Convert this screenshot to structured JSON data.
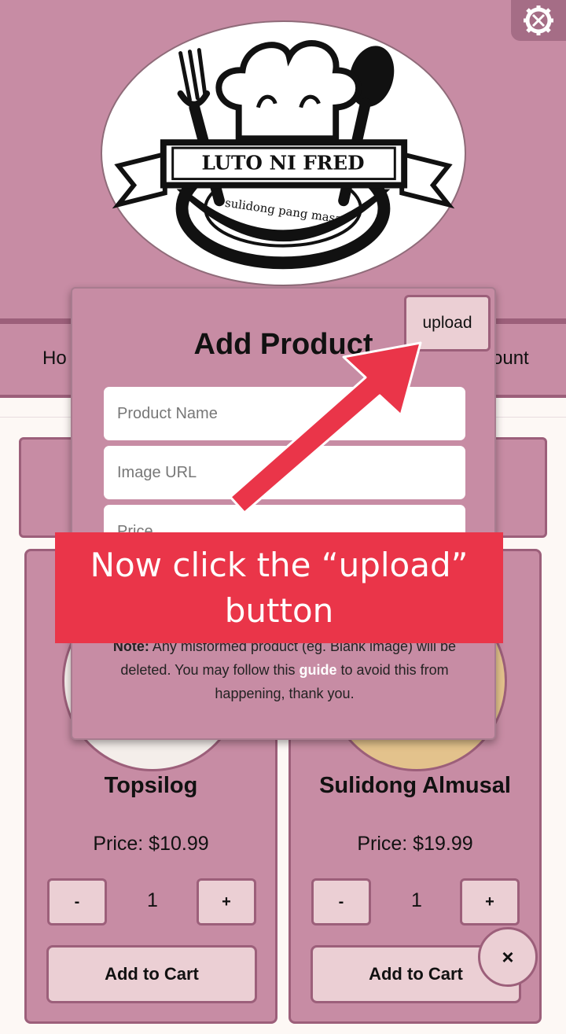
{
  "logo": {
    "name_text": "LUTO NI FRED",
    "slogan_text": "sulidong pang masa"
  },
  "nav": {
    "home_label": "Ho",
    "account_label": "ount"
  },
  "modal": {
    "title": "Add Product",
    "upload_label": "upload",
    "product_name_placeholder": "Product Name",
    "image_url_placeholder": "Image URL",
    "price_placeholder": "Price",
    "note_label": "Note:",
    "note_text_1": " Any misformed product (eg. Blank image) will be deleted. You may follow this ",
    "guide_link": "guide",
    "note_text_2": " to avoid this from happening, thank you."
  },
  "products": [
    {
      "title": "Topsilog",
      "price": "Price: $10.99",
      "quantity": "1",
      "minus": "-",
      "plus": "+",
      "add_label": "Add to Cart"
    },
    {
      "title": "Sulidong Almusal",
      "price": "Price: $19.99",
      "quantity": "1",
      "minus": "-",
      "plus": "+",
      "add_label": "Add to Cart"
    }
  ],
  "close_button": "×",
  "overlay": {
    "instruction_text": "Now click the “upload” button"
  },
  "colors": {
    "header_bg": "#c78ca4",
    "accent_border": "#9c5f7a",
    "button_bg": "#ebcfd4",
    "highlight_red": "#ea3549"
  },
  "icons": {
    "settings": "settings-tools-icon",
    "close": "close-icon",
    "arrow": "pointer-arrow"
  }
}
